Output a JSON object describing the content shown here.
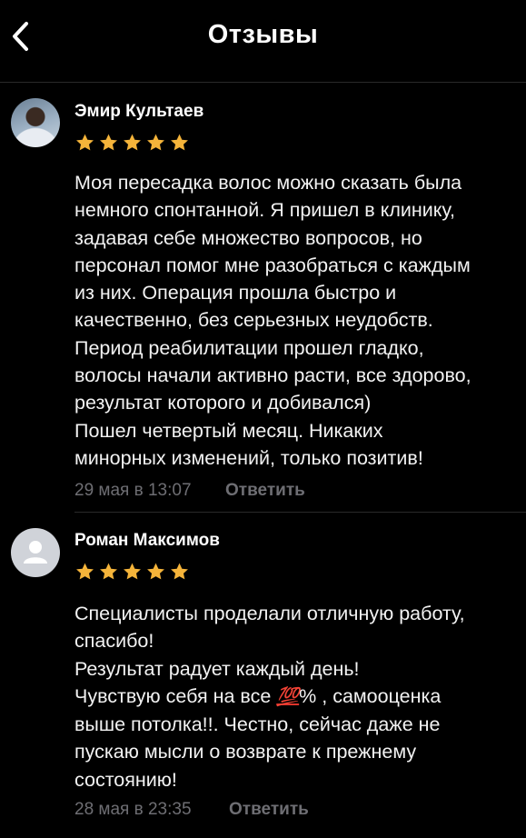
{
  "header": {
    "title": "Отзывы"
  },
  "reviews": [
    {
      "author": "Эмир Культаев",
      "rating": 5,
      "text": "Моя пересадка волос можно сказать была\nнемного спонтанной. Я пришел в клинику,\nзадавая себе множество вопросов, но\nперсонал помог мне разобраться с каждым\nиз них. Операция прошла быстро и\nкачественно, без серьезных неудобств.\nПериод реабилитации прошел гладко,\nволосы начали активно расти, все здорово,\nрезультат которого и добивался)\nПошел четвертый месяц. Никаких\nминорных изменений, только позитив!",
      "date": "29 мая в 13:07",
      "reply_label": "Ответить"
    },
    {
      "author": "Роман Максимов",
      "rating": 5,
      "text_before": "Специалисты проделали отличную работу,\nспасибо!\nРезультат радует каждый день!\nЧувствую себя на все ",
      "emoji": "💯",
      "text_after": "% , самооценка\nвыше потолка!!. Честно, сейчас даже не\nпускаю мысли о возврате к прежнему\nсостоянию!",
      "date": "28 мая в 23:35",
      "reply_label": "Ответить"
    }
  ],
  "colors": {
    "star": "#f5b43a",
    "meta": "#6e6e73",
    "background": "#000000"
  },
  "icons": {
    "back": "chevron-left-icon",
    "star": "star-icon",
    "avatar_placeholder": "user-silhouette-icon"
  }
}
